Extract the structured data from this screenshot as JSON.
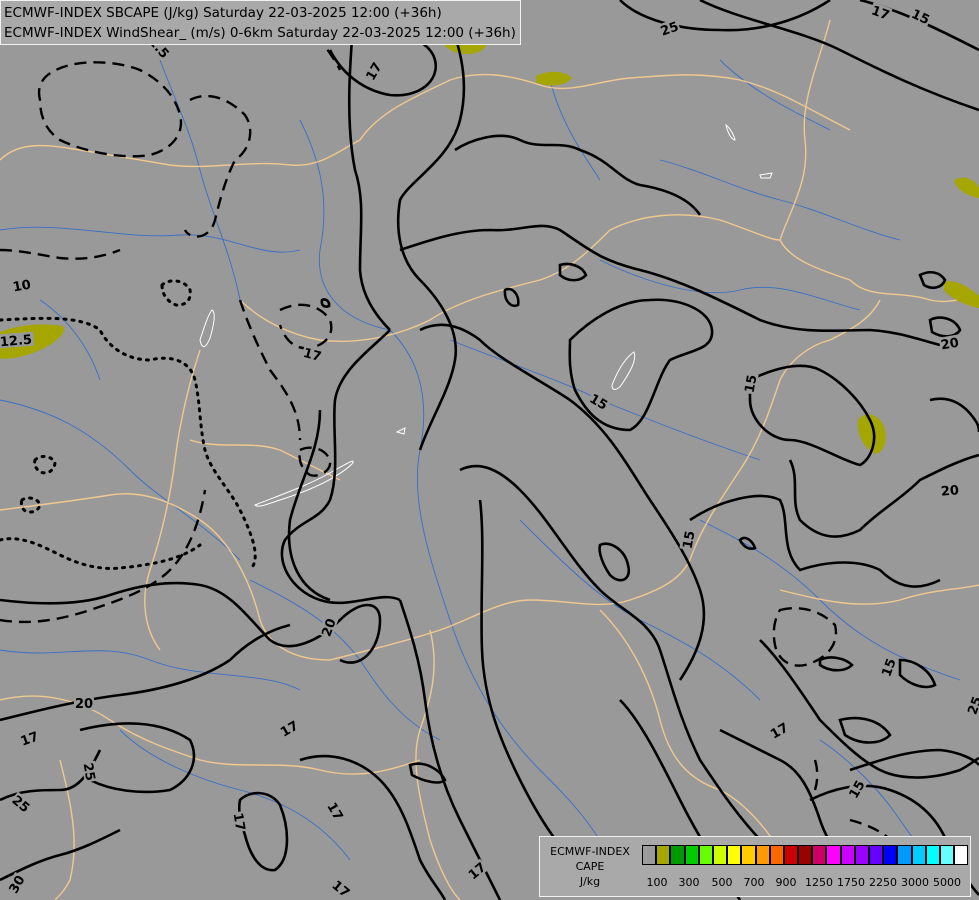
{
  "header": {
    "line1": "ECMWF-INDEX SBCAPE (J/kg) Saturday 22-03-2025 12:00 (+36h)",
    "line2": "ECMWF-INDEX WindShear_ (m/s) 0-6km Saturday 22-03-2025 12:00 (+36h)"
  },
  "legend": {
    "name_line1": "ECMWF-INDEX",
    "name_line2": "CAPE",
    "unit": "J/kg",
    "swatch_colors": [
      "#9b9b9b",
      "#a6a600",
      "#009900",
      "#00cc00",
      "#66ff00",
      "#ccff00",
      "#ffff00",
      "#ffcc00",
      "#ff9900",
      "#ff6600",
      "#cc0000",
      "#990000",
      "#cc0066",
      "#ff00ff",
      "#cc00ff",
      "#9900ff",
      "#6600ff",
      "#0000ff",
      "#0099ff",
      "#00ccff",
      "#00ffff",
      "#66ffff",
      "#ffffff"
    ],
    "tick_labels": [
      "100",
      "300",
      "500",
      "700",
      "900",
      "1250",
      "1750",
      "2250",
      "3000",
      "5000"
    ]
  },
  "map": {
    "background": "#999999",
    "border_color": "#f0c890",
    "river_color": "#3a6ec8",
    "cape_fill": "#a6a600",
    "contour_labels": [
      "20",
      "25",
      "17",
      "15",
      "17",
      "12.5",
      "10",
      "12.5",
      "17",
      "20",
      "15",
      "15",
      "20",
      "15",
      "17",
      "15",
      "20",
      "25",
      "17",
      "17",
      "25",
      "17",
      "17",
      "17",
      "25",
      "30",
      "20",
      "17",
      "15"
    ]
  }
}
